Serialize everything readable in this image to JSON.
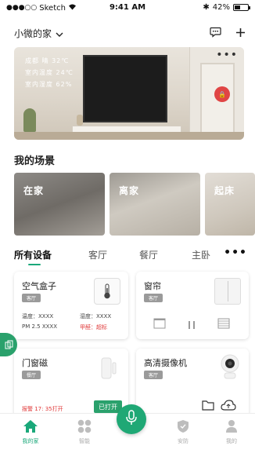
{
  "status_bar": {
    "signal": "●●●○○",
    "carrier": "Sketch",
    "time": "9:41 AM",
    "battery": "42%",
    "battery_level": 0.42
  },
  "header": {
    "home_name": "小微的家"
  },
  "hero": {
    "weather": "成都 晴 32℃",
    "indoor_temp": "室内温度 24℃",
    "indoor_humidity": "室内湿度 62%",
    "more": "•••",
    "badge": "🔒"
  },
  "scenes": {
    "title": "我的场景",
    "items": [
      {
        "label": "在家"
      },
      {
        "label": "离家"
      },
      {
        "label": "起床"
      }
    ]
  },
  "rooms": {
    "tabs": [
      {
        "label": "所有设备"
      },
      {
        "label": "客厅"
      },
      {
        "label": "餐厅"
      },
      {
        "label": "主卧"
      }
    ],
    "more": "•••"
  },
  "devices": {
    "air_box": {
      "name": "空气盒子",
      "room": "客厅",
      "temp_label": "温度：XXXX",
      "humidity_label": "湿度：XXXX",
      "pm_label": "PM 2.5  XXXX",
      "alert": "甲醛：超标"
    },
    "curtain": {
      "name": "窗帘",
      "room": "客厅"
    },
    "door_sensor": {
      "name": "门窗磁",
      "room": "餐厅",
      "alarm": "报警  17: 35打开",
      "state_button": "已打开"
    },
    "camera": {
      "name": "高清摄像机",
      "room": "客厅"
    }
  },
  "tabbar": {
    "items": [
      {
        "label": "我的家"
      },
      {
        "label": "智能"
      },
      {
        "label": "安防"
      },
      {
        "label": "我的"
      }
    ]
  },
  "colors": {
    "accent": "#1ba87a",
    "alert": "#e03a3a",
    "tag": "#9a9a9a"
  }
}
